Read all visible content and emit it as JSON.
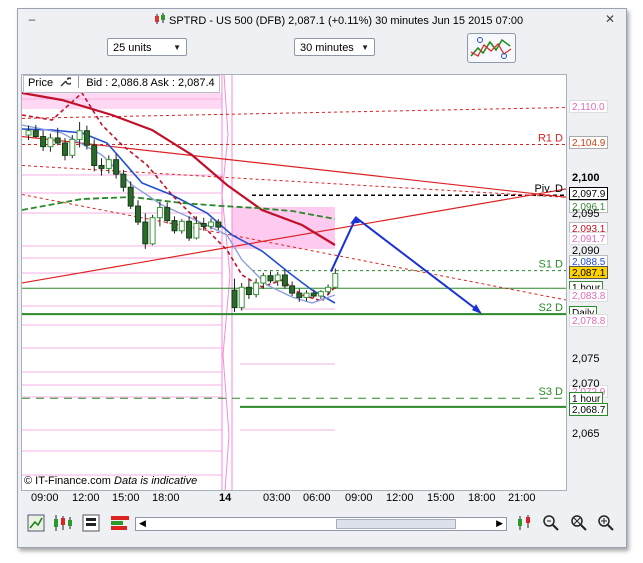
{
  "window": {
    "title": "SPTRD - US 500 (DFB)   2,087.1 (+0.11%)   30 minutes  Jun 15 2015 07:00"
  },
  "toolbar": {
    "units_value": "25 units",
    "period_value": "30 minutes"
  },
  "legend": {
    "price_label": "Price",
    "bid_ask": "Bid : 2,086.8  Ask : 2,087.4"
  },
  "watermark": {
    "brand": "© IT-Finance.com",
    "note": "Data is indicative"
  },
  "yaxis": {
    "ticks": [
      "2,110.0",
      "2,104.9",
      "2,100",
      "2,097.9",
      "2,096.1",
      "2,095",
      "2,093.1",
      "2,091.7",
      "2,090",
      "2,088.5",
      "2,087.1",
      "1 hour",
      "2,083.8",
      "Daily",
      "2,078.8",
      "2,075",
      "2,070",
      "2,072.9",
      "1 hour",
      "2,068.7",
      "2,065"
    ]
  },
  "xaxis": {
    "ticks": [
      "09:00",
      "12:00",
      "15:00",
      "18:00",
      "14",
      "03:00",
      "06:00",
      "09:00",
      "12:00",
      "15:00",
      "18:00",
      "21:00"
    ]
  },
  "levels": {
    "r1": "R1 D",
    "piv": "Piv. D",
    "s1": "S1 D",
    "s2": "S2 D",
    "s3": "S3 D"
  },
  "chart_data": {
    "type": "candlestick",
    "title": "SPTRD - US 500 (DFB)",
    "period": "30 minutes",
    "ylim": [
      2063,
      2112
    ],
    "last_price": 2087.1,
    "change_pct": "+0.11%",
    "bid": 2086.8,
    "ask": 2087.4,
    "pivots": {
      "R1 D": 2104.9,
      "Piv. D": 2097.9,
      "S1 D": 2087.5,
      "S2 D": 2081.5,
      "S3 D": 2069.9
    },
    "price_labels": [
      2110.0,
      2104.9,
      2097.9,
      2096.1,
      2093.1,
      2091.7,
      2088.5,
      2087.1,
      2083.8,
      2078.8,
      2072.9,
      2068.7
    ],
    "y_ticks": [
      2100,
      2095,
      2090,
      2075,
      2070,
      2065
    ],
    "x_ticks": [
      "09:00",
      "12:00",
      "15:00",
      "18:00",
      "14",
      "03:00",
      "06:00",
      "09:00",
      "12:00",
      "15:00",
      "18:00",
      "21:00"
    ],
    "candles": [
      {
        "o": 2106.2,
        "h": 2107.5,
        "l": 2105.5,
        "c": 2106.8
      },
      {
        "o": 2106.8,
        "h": 2107.6,
        "l": 2105.8,
        "c": 2106.0
      },
      {
        "o": 2106.0,
        "h": 2106.8,
        "l": 2104.0,
        "c": 2104.6
      },
      {
        "o": 2104.6,
        "h": 2106.4,
        "l": 2103.9,
        "c": 2105.8
      },
      {
        "o": 2105.8,
        "h": 2107.2,
        "l": 2104.8,
        "c": 2105.1
      },
      {
        "o": 2105.1,
        "h": 2105.8,
        "l": 2102.7,
        "c": 2103.4
      },
      {
        "o": 2103.4,
        "h": 2106.2,
        "l": 2103.0,
        "c": 2105.6
      },
      {
        "o": 2105.6,
        "h": 2108.0,
        "l": 2104.5,
        "c": 2106.8
      },
      {
        "o": 2106.8,
        "h": 2107.5,
        "l": 2104.2,
        "c": 2104.8
      },
      {
        "o": 2104.8,
        "h": 2105.6,
        "l": 2101.2,
        "c": 2102.0
      },
      {
        "o": 2102.0,
        "h": 2103.0,
        "l": 2100.6,
        "c": 2101.6
      },
      {
        "o": 2101.6,
        "h": 2103.4,
        "l": 2100.9,
        "c": 2102.8
      },
      {
        "o": 2102.8,
        "h": 2103.6,
        "l": 2100.2,
        "c": 2100.8
      },
      {
        "o": 2100.8,
        "h": 2101.4,
        "l": 2098.4,
        "c": 2099.0
      },
      {
        "o": 2099.0,
        "h": 2099.8,
        "l": 2096.0,
        "c": 2096.4
      },
      {
        "o": 2096.4,
        "h": 2097.2,
        "l": 2093.8,
        "c": 2094.2
      },
      {
        "o": 2094.2,
        "h": 2095.4,
        "l": 2090.5,
        "c": 2091.2
      },
      {
        "o": 2091.2,
        "h": 2095.2,
        "l": 2091.0,
        "c": 2094.8
      },
      {
        "o": 2094.8,
        "h": 2097.0,
        "l": 2093.6,
        "c": 2096.2
      },
      {
        "o": 2096.2,
        "h": 2096.9,
        "l": 2094.0,
        "c": 2094.4
      },
      {
        "o": 2094.4,
        "h": 2095.0,
        "l": 2092.6,
        "c": 2093.0
      },
      {
        "o": 2093.0,
        "h": 2094.6,
        "l": 2092.6,
        "c": 2094.3
      },
      {
        "o": 2094.3,
        "h": 2095.0,
        "l": 2091.6,
        "c": 2092.0
      },
      {
        "o": 2092.0,
        "h": 2095.0,
        "l": 2091.8,
        "c": 2094.0
      },
      {
        "o": 2094.0,
        "h": 2094.8,
        "l": 2093.0,
        "c": 2093.6
      },
      {
        "o": 2093.6,
        "h": 2094.7,
        "l": 2093.2,
        "c": 2094.2
      },
      {
        "o": 2094.2,
        "h": 2094.6,
        "l": 2093.1,
        "c": 2093.5
      },
      {
        "o": 2084.8,
        "h": 2086.4,
        "l": 2081.8,
        "c": 2082.4
      },
      {
        "o": 2082.4,
        "h": 2085.8,
        "l": 2082.0,
        "c": 2085.2
      },
      {
        "o": 2085.2,
        "h": 2086.2,
        "l": 2083.6,
        "c": 2084.2
      },
      {
        "o": 2084.2,
        "h": 2086.4,
        "l": 2083.8,
        "c": 2085.8
      },
      {
        "o": 2085.8,
        "h": 2087.2,
        "l": 2085.0,
        "c": 2086.8
      },
      {
        "o": 2086.8,
        "h": 2087.4,
        "l": 2085.8,
        "c": 2086.1
      },
      {
        "o": 2086.1,
        "h": 2087.3,
        "l": 2085.4,
        "c": 2086.9
      },
      {
        "o": 2086.9,
        "h": 2087.6,
        "l": 2085.0,
        "c": 2085.4
      },
      {
        "o": 2085.4,
        "h": 2086.0,
        "l": 2084.0,
        "c": 2084.4
      },
      {
        "o": 2084.4,
        "h": 2085.0,
        "l": 2083.2,
        "c": 2083.8
      },
      {
        "o": 2083.8,
        "h": 2084.8,
        "l": 2083.3,
        "c": 2084.4
      },
      {
        "o": 2084.4,
        "h": 2084.9,
        "l": 2083.7,
        "c": 2084.0
      },
      {
        "o": 2084.0,
        "h": 2084.8,
        "l": 2083.6,
        "c": 2084.6
      },
      {
        "o": 2084.6,
        "h": 2085.6,
        "l": 2084.2,
        "c": 2085.2
      },
      {
        "o": 2085.2,
        "h": 2087.8,
        "l": 2085.0,
        "c": 2087.1
      }
    ]
  },
  "colors": {
    "bull": "#3a9a3a",
    "bear": "#1a1a1a",
    "resistance": "#dd2222",
    "support": "#2a8a2a",
    "pivot": "#000000",
    "arrow": "#1a2fd6",
    "ma_blue": "#1f4fd0",
    "ma_red": "#c0102a",
    "band": "#ff9fe8"
  },
  "icons": {
    "title_icon": "candlestick-icon",
    "minimize": "minimize-icon",
    "close": "close-icon",
    "bottom": [
      "chart-type-icon",
      "candles-icon",
      "bars-icon",
      "barchart-icon",
      "scroll-left-icon",
      "scroll-right-icon",
      "indicators-icon",
      "zoom-auto-icon",
      "zoom-reset-icon",
      "zoom-in-icon"
    ]
  }
}
